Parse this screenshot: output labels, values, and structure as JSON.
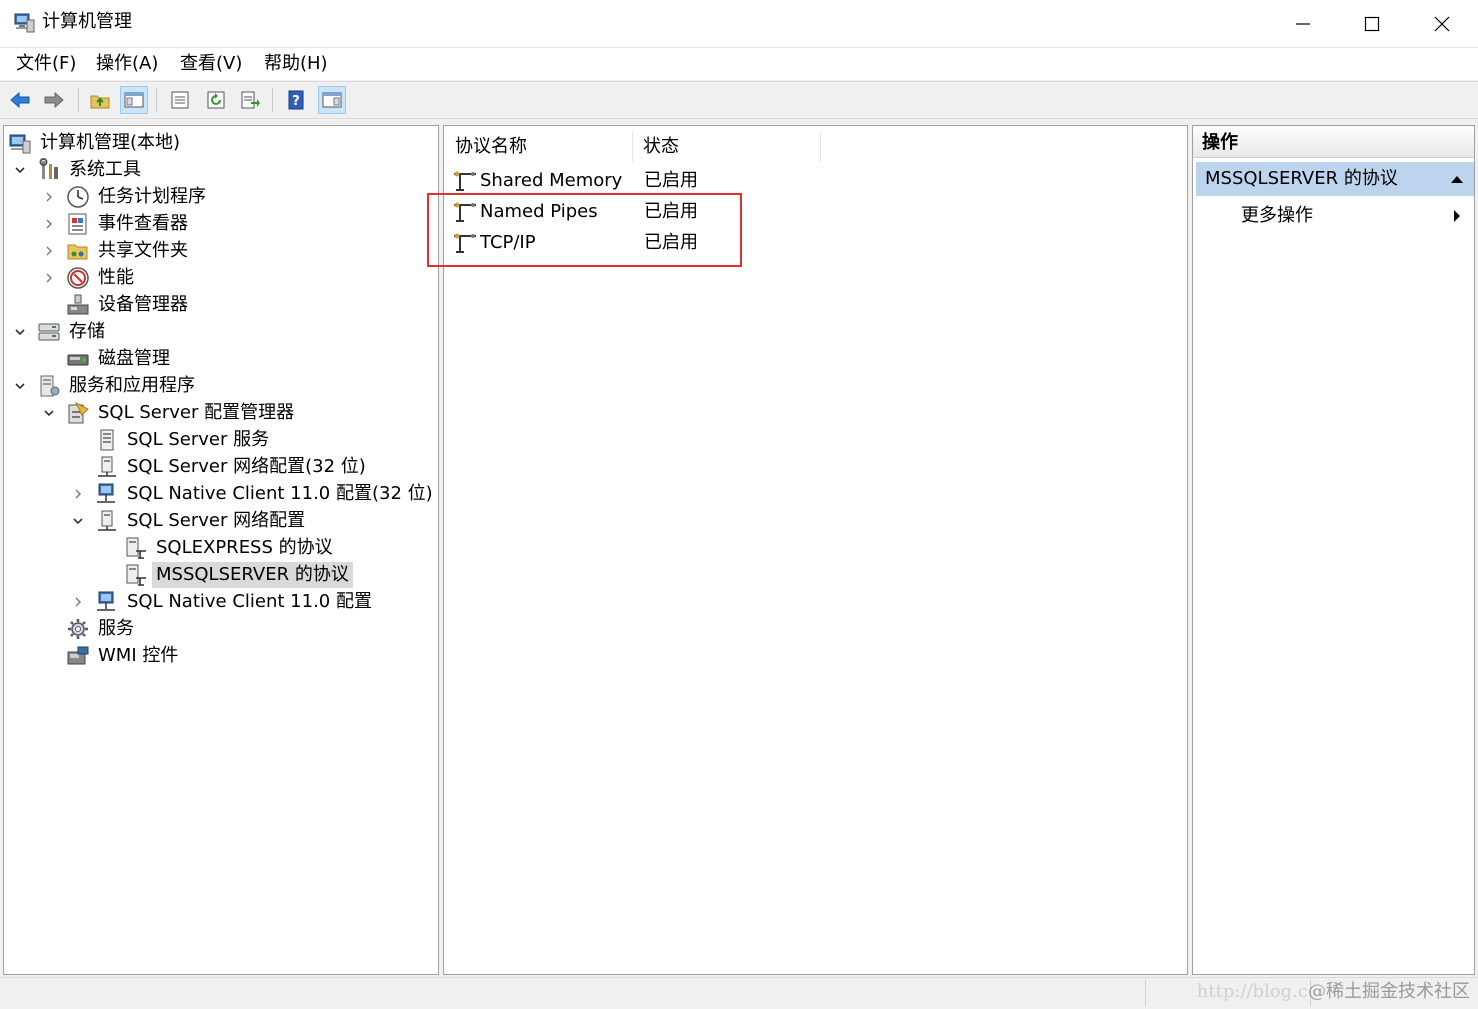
{
  "window": {
    "title": "计算机管理"
  },
  "menu": [
    "文件(F)",
    "操作(A)",
    "查看(V)",
    "帮助(H)"
  ],
  "toolbar": {
    "icons": [
      "back-arrow-icon",
      "forward-arrow-icon",
      "up-folder-icon",
      "show-hide-tree-icon",
      "properties-icon",
      "refresh-icon",
      "export-list-icon",
      "help-icon",
      "show-hide-action-pane-icon"
    ]
  },
  "tree": {
    "root": "计算机管理(本地)",
    "system_tools": "系统工具",
    "task_scheduler": "任务计划程序",
    "event_viewer": "事件查看器",
    "shared_folders": "共享文件夹",
    "performance": "性能",
    "device_manager": "设备管理器",
    "storage": "存储",
    "disk_management": "磁盘管理",
    "services_apps": "服务和应用程序",
    "sql_config_manager": "SQL Server 配置管理器",
    "sql_services": "SQL Server 服务",
    "sql_net_config_32": "SQL Server 网络配置(32 位)",
    "native_client_32": "SQL Native Client 11.0 配置(32 位)",
    "sql_net_config": "SQL Server 网络配置",
    "sqlexpress_protocols": "SQLEXPRESS 的协议",
    "mssqlserver_protocols": "MSSQLSERVER 的协议",
    "native_client": "SQL Native Client 11.0 配置",
    "services": "服务",
    "wmi": "WMI 控件"
  },
  "list": {
    "columns": [
      "协议名称",
      "状态"
    ],
    "rows": [
      {
        "name": "Shared Memory",
        "status": "已启用"
      },
      {
        "name": "Named Pipes",
        "status": "已启用"
      },
      {
        "name": "TCP/IP",
        "status": "已启用"
      }
    ]
  },
  "actions": {
    "header": "操作",
    "section": "MSSQLSERVER 的协议",
    "more": "更多操作"
  },
  "status": {
    "watermark_url": "http://blog.c",
    "watermark_brand": "@稀土掘金技术社区"
  },
  "colors": {
    "selection": "#d9d9d9",
    "action_section": "#bdd4ee",
    "highlight_box": "#e03030"
  }
}
